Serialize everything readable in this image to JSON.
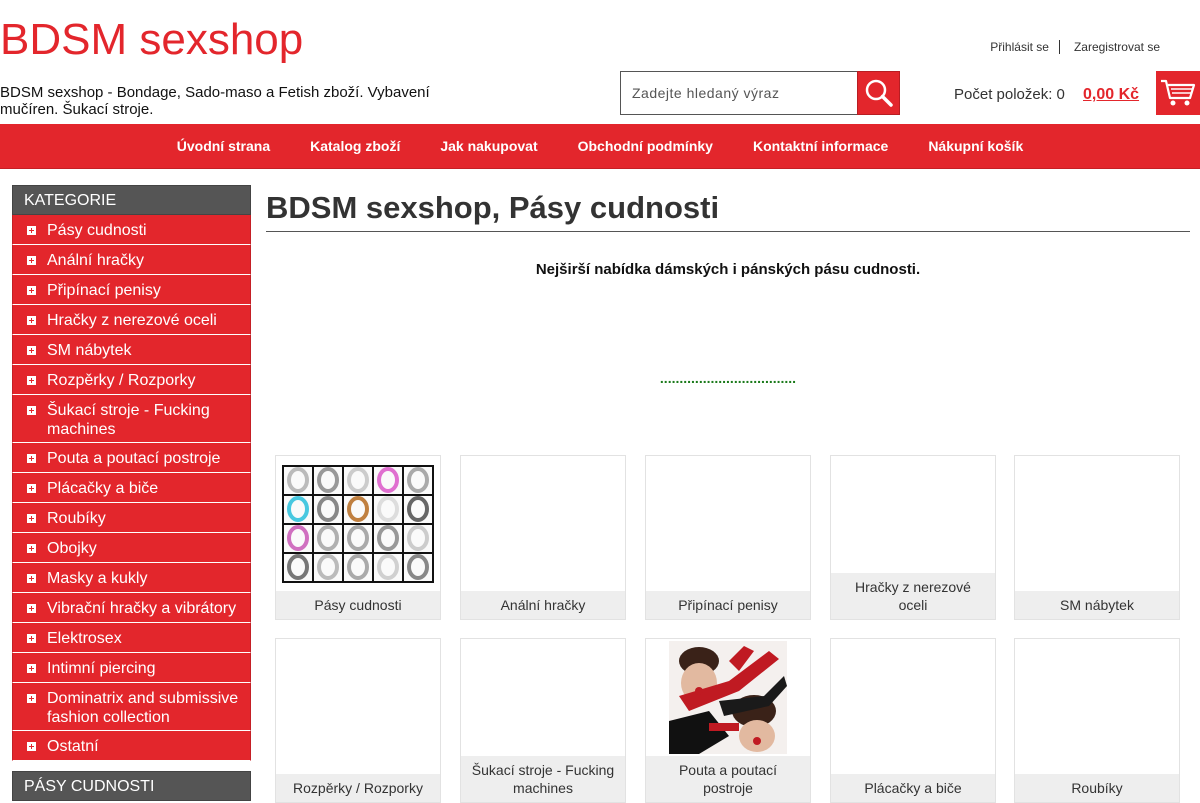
{
  "site": {
    "title": "BDSM sexshop",
    "description": "BDSM sexshop - Bondage, Sado-maso a Fetish zboží. Vybavení mučíren. Šukací stroje."
  },
  "account": {
    "login": "Přihlásit se",
    "register": "Zaregistrovat se"
  },
  "search": {
    "placeholder": "Zadejte hledaný výraz",
    "icon": "search-icon"
  },
  "cart": {
    "items_label": "Počet položek: 0",
    "total": "0,00 Kč",
    "icon": "cart-icon"
  },
  "nav": [
    "Úvodní strana",
    "Katalog zboží",
    "Jak nakupovat",
    "Obchodní podmínky",
    "Kontaktní informace",
    "Nákupní košík"
  ],
  "sidebar": {
    "heading": "KATEGORIE",
    "items": [
      "Pásy cudnosti",
      "Anální hračky",
      "Připínací penisy",
      "Hračky z nerezové oceli",
      "SM nábytek",
      "Rozpěrky / Rozporky",
      "Šukací stroje - Fucking machines",
      "Pouta a poutací postroje",
      "Plácačky a biče",
      "Roubíky",
      "Obojky",
      "Masky a kukly",
      "Vibrační hračky a vibrátory",
      "Elektrosex",
      "Intimní piercing",
      "Dominatrix and submissive fashion collection",
      "Ostatní"
    ],
    "heading2": "PÁSY CUDNOSTI"
  },
  "main": {
    "title": "BDSM sexshop, Pásy cudnosti",
    "intro": "Nejširší nabídka dámských i pánských pásu cudnosti.",
    "dots": "..................................."
  },
  "cards": [
    {
      "label": "Pásy cudnosti",
      "image": "chastity-devices-grid"
    },
    {
      "label": "Anální hračky",
      "image": ""
    },
    {
      "label": "Připínací penisy",
      "image": ""
    },
    {
      "label": "Hračky z nerezové oceli",
      "image": ""
    },
    {
      "label": "SM nábytek",
      "image": ""
    },
    {
      "label": "Rozpěrky / Rozporky",
      "image": ""
    },
    {
      "label": "Šukací stroje - Fucking machines",
      "image": ""
    },
    {
      "label": "Pouta a poutací postroje",
      "image": "bondage-harness-photo"
    },
    {
      "label": "Plácačky a biče",
      "image": ""
    },
    {
      "label": "Roubíky",
      "image": ""
    }
  ],
  "colors": {
    "brand": "#e3262c",
    "sidebar_heading": "#555555",
    "dots": "#1b7a1b"
  }
}
